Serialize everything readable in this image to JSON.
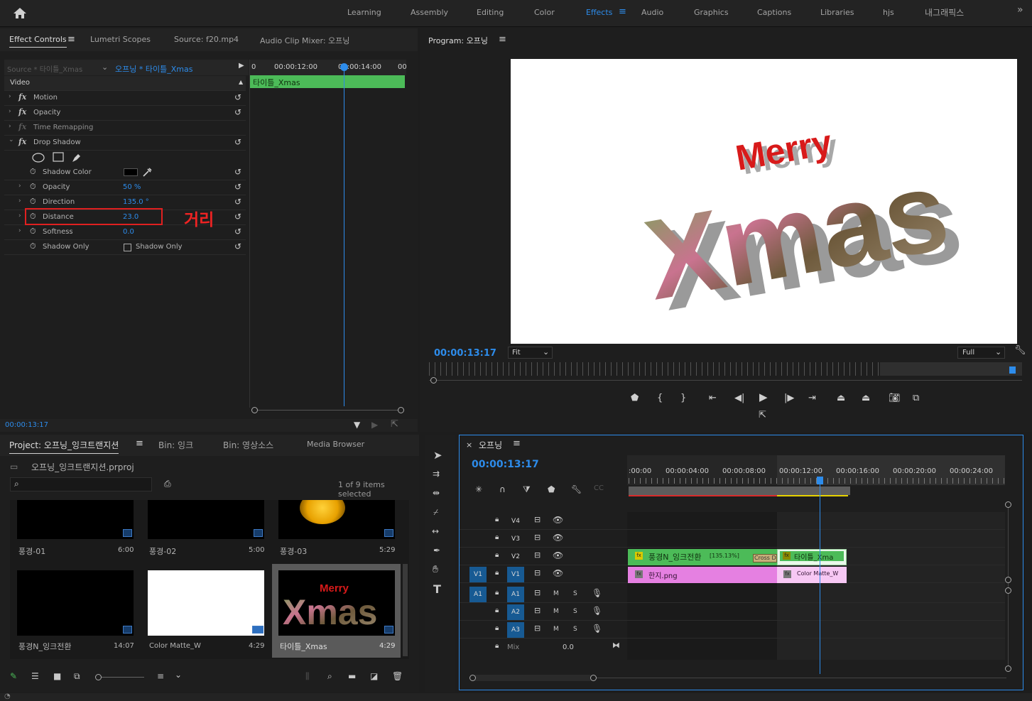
{
  "workspaces": [
    "Learning",
    "Assembly",
    "Editing",
    "Color",
    "Effects",
    "Audio",
    "Graphics",
    "Captions",
    "Libraries",
    "hjs",
    "내그래픽스"
  ],
  "active_workspace": "Effects",
  "effect_panel": {
    "tabs": [
      "Effect Controls",
      "Lumetri Scopes",
      "Source: f20.mp4",
      "Audio Clip Mixer: 오프닝"
    ],
    "source_label": "Source * 타이틀_Xmas",
    "sequence_label": "오프닝 * 타이틀_Xmas",
    "ruler": [
      "00:00:12:00",
      "00:00:14:00"
    ],
    "ruler_left": "0",
    "ruler_right": "00",
    "clip_label": "타이틀_Xmas",
    "section": "Video",
    "effects": [
      "Motion",
      "Opacity",
      "Time Remapping",
      "Drop Shadow"
    ],
    "params": [
      {
        "name": "Shadow Color",
        "value": ""
      },
      {
        "name": "Opacity",
        "value": "50 %"
      },
      {
        "name": "Direction",
        "value": "135.0 °"
      },
      {
        "name": "Distance",
        "value": "23.0"
      },
      {
        "name": "Softness",
        "value": "0.0"
      },
      {
        "name": "Shadow Only",
        "value": "Shadow Only"
      }
    ],
    "annotation": "거리",
    "timecode": "00:00:13:17"
  },
  "program": {
    "title": "Program: 오프닝",
    "timecode": "00:00:13:17",
    "fit": "Fit",
    "quality": "Full",
    "title_top": "Merry",
    "title_main": "Xmas"
  },
  "project": {
    "tabs": [
      "Project: 오프닝_잉크트랜지션",
      "Bin: 잉크",
      "Bin: 영상소스",
      "Media Browser"
    ],
    "filename": "오프닝_잉크트랜지션.prproj",
    "selection": "1 of 9 items selected",
    "items": [
      {
        "name": "풍경-01",
        "dur": "6:00"
      },
      {
        "name": "풍경-02",
        "dur": "5:00"
      },
      {
        "name": "풍경-03",
        "dur": "5:29"
      },
      {
        "name": "풍경N_잉크전환",
        "dur": "14:07"
      },
      {
        "name": "Color Matte_W",
        "dur": "4:29"
      },
      {
        "name": "타이틀_Xmas",
        "dur": "4:29"
      }
    ],
    "thumb_merry": "Merry",
    "thumb_xmas": "Xmas"
  },
  "timeline": {
    "title": "오프닝",
    "timecode": "00:00:13:17",
    "ruler": [
      ":00:00",
      "00:00:04:00",
      "00:00:08:00",
      "00:00:12:00",
      "00:00:16:00",
      "00:00:20:00",
      "00:00:24:00"
    ],
    "video_tracks": [
      "V4",
      "V3",
      "V2",
      "V1"
    ],
    "audio_tracks": [
      "A1",
      "A2",
      "A3"
    ],
    "src_v": "V1",
    "src_a": "A1",
    "mix_label": "Mix",
    "mix_value": "0.0",
    "m": "M",
    "s": "S",
    "clips": {
      "v2a": "풍경N_잉크전환",
      "v2a_pct": "[135.13%]",
      "cross": "Cross Di",
      "v2b": "타이틀_Xma",
      "v1a": "한지.png",
      "v1b": "Color Matte_W"
    }
  }
}
